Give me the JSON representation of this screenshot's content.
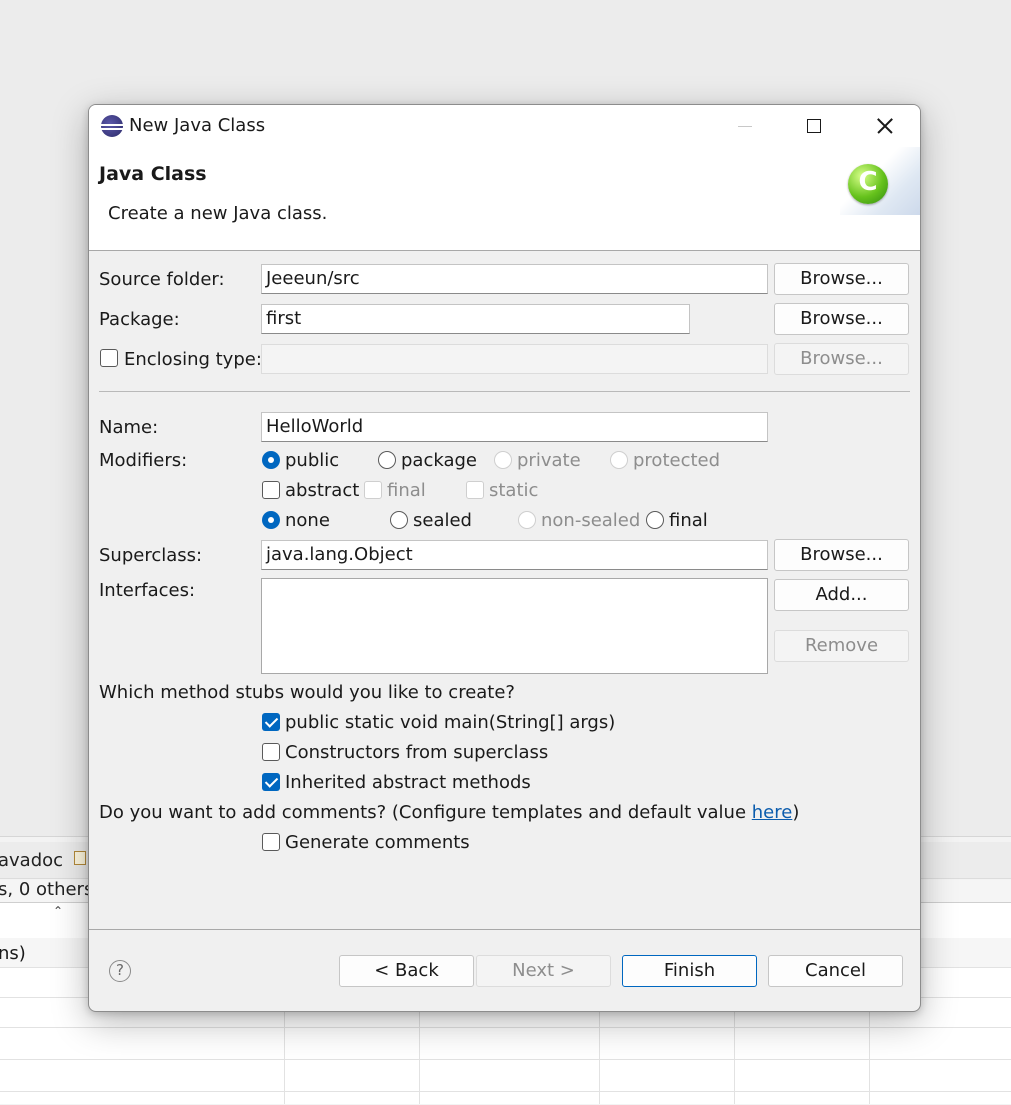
{
  "background": {
    "tab_label": "avadoc",
    "summary_text": "s, 0 others",
    "row1_text": "ns)"
  },
  "dialog": {
    "title": "New Java Class",
    "header_title": "Java Class",
    "header_description": "Create a new Java class.",
    "class_icon_letter": "C",
    "source_folder": {
      "label": "Source folder:",
      "value": "Jeeeun/src",
      "browse_label": "Browse..."
    },
    "package": {
      "label": "Package:",
      "value": "first",
      "browse_label": "Browse..."
    },
    "enclosing_type": {
      "label": "Enclosing type:",
      "checked": false,
      "value": "",
      "browse_label": "Browse..."
    },
    "name": {
      "label": "Name:",
      "value": "HelloWorld"
    },
    "modifiers": {
      "label": "Modifiers:",
      "access": [
        {
          "label": "public",
          "selected": true
        },
        {
          "label": "package",
          "selected": false
        },
        {
          "label": "private",
          "selected": false,
          "enabled": false
        },
        {
          "label": "protected",
          "selected": false,
          "enabled": false
        }
      ],
      "flags": [
        {
          "label": "abstract",
          "checked": false
        },
        {
          "label": "final",
          "checked": false,
          "enabled": false
        },
        {
          "label": "static",
          "checked": false,
          "enabled": false
        }
      ],
      "sealing": [
        {
          "label": "none",
          "selected": true
        },
        {
          "label": "sealed",
          "selected": false
        },
        {
          "label": "non-sealed",
          "selected": false,
          "enabled": false
        },
        {
          "label": "final",
          "selected": false
        }
      ]
    },
    "superclass": {
      "label": "Superclass:",
      "value": "java.lang.Object",
      "browse_label": "Browse..."
    },
    "interfaces": {
      "label": "Interfaces:",
      "add_label": "Add...",
      "remove_label": "Remove"
    },
    "stubs": {
      "question": "Which method stubs would you like to create?",
      "options": [
        {
          "label": "public static void main(String[] args)",
          "checked": true
        },
        {
          "label": "Constructors from superclass",
          "checked": false
        },
        {
          "label": "Inherited abstract methods",
          "checked": true
        }
      ]
    },
    "comments": {
      "question_prefix": "Do you want to add comments? (Configure templates and default value ",
      "link_text": "here",
      "question_suffix": ")",
      "generate_label": "Generate comments",
      "generate_checked": false
    },
    "buttons": {
      "back": "< Back",
      "next": "Next >",
      "finish": "Finish",
      "cancel": "Cancel"
    },
    "help_glyph": "?"
  },
  "colors": {
    "accent": "#0067c0",
    "link": "#0b5cad",
    "dialog_bg": "#f0f0f0"
  }
}
